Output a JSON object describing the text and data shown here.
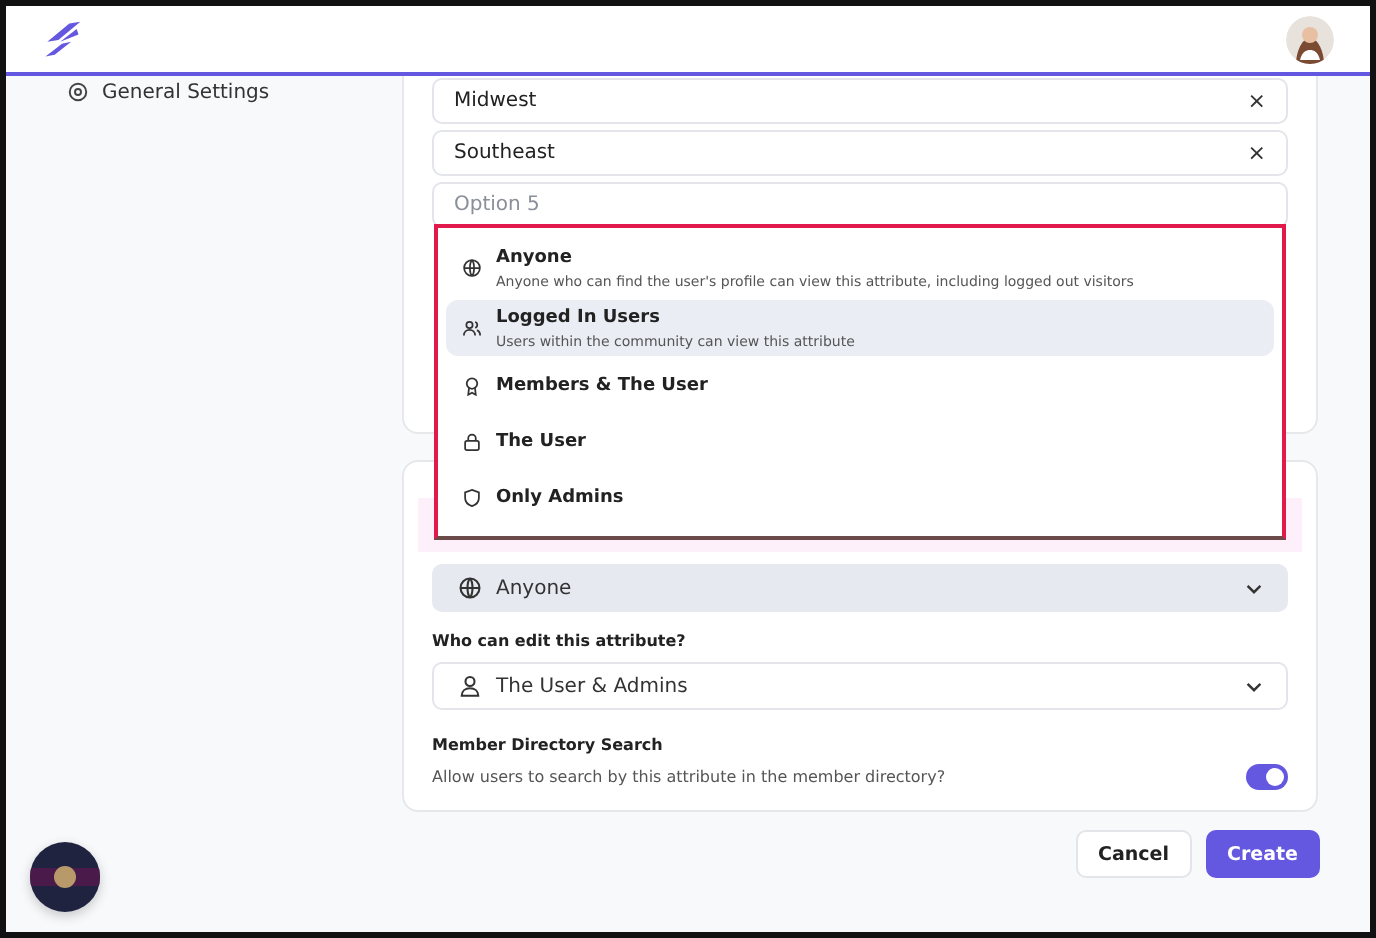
{
  "sidebar": {
    "items": [
      {
        "label": "General Settings"
      }
    ]
  },
  "options": [
    {
      "value": "Midwest",
      "remove": "×"
    },
    {
      "value": "Southeast",
      "remove": "×"
    }
  ],
  "new_option": {
    "placeholder": "Option 5"
  },
  "visibility_menu": {
    "options": [
      {
        "kind": "globe",
        "label": "Anyone",
        "description": "Anyone who can find the user's profile can view this attribute, including logged out visitors",
        "selected": false
      },
      {
        "kind": "users",
        "label": "Logged In Users",
        "description": "Users within the community can view this attribute",
        "selected": true
      },
      {
        "kind": "award",
        "label": "Members & The User",
        "selected": false
      },
      {
        "kind": "lock",
        "label": "The User",
        "selected": false
      },
      {
        "kind": "shield",
        "label": "Only Admins",
        "selected": false
      }
    ]
  },
  "visibility_select": {
    "kind": "globe",
    "value": "Anyone"
  },
  "edit_label": "Who can edit this attribute?",
  "edit_select": {
    "kind": "user",
    "value": "The User & Admins"
  },
  "directory_search": {
    "title": "Member Directory Search",
    "description": "Allow users to search by this attribute in the member directory?",
    "on": true
  },
  "buttons": [
    {
      "label": "Cancel",
      "kind": "secondary"
    },
    {
      "label": "Create",
      "kind": "primary"
    }
  ]
}
